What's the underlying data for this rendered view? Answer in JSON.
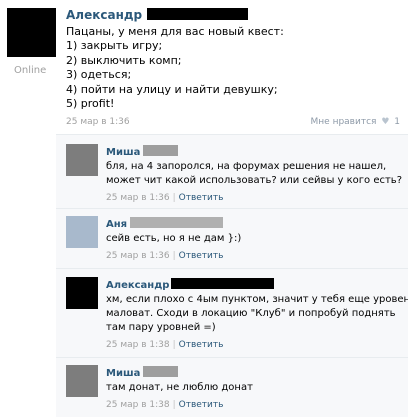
{
  "post": {
    "author": "Александр",
    "status": "Online",
    "text": "Пацаны, у меня для вас новый квест:\n1) закрыть игру;\n2) выключить комп;\n3) одеться;\n4) пойти на улицу и найти девушку;\n5) profit!",
    "timestamp": "25 мар в 1:36",
    "likes_label": "Мне нравится",
    "likes_count": "1",
    "censor_color": "#000000"
  },
  "comments": [
    {
      "author": "Миша",
      "text": "бля, на 4 запоролся, на форумах решения не нашел,\nможет чит какой использовать? или сейвы у кого есть?",
      "timestamp": "25 мар в 1:36",
      "reply_label": "Ответить",
      "avatar_color": "#7d7d7d"
    },
    {
      "author": "Аня",
      "text": "сейв есть, но я не дам }:)",
      "timestamp": "25 мар в 1:36",
      "reply_label": "Ответить",
      "avatar_color": "#a8b9cc"
    },
    {
      "author": "Александр",
      "text": "хм, если плохо с 4ым пунктом, значит у тебя еще уровень\nмаловат. Сходи в локацию \"Клуб\" и попробуй поднять\nтам пару уровней =)",
      "timestamp": "25 мар в 1:38",
      "reply_label": "Ответить",
      "avatar_color": "#000000"
    },
    {
      "author": "Миша",
      "text": "там донат, не люблю донат",
      "timestamp": "25 мар в 1:38",
      "reply_label": "Ответить",
      "avatar_color": "#7d7d7d"
    }
  ],
  "colors": {
    "link": "#2b587a",
    "meta": "#a0a0a0",
    "comment_bg": "#f7f8fa"
  }
}
